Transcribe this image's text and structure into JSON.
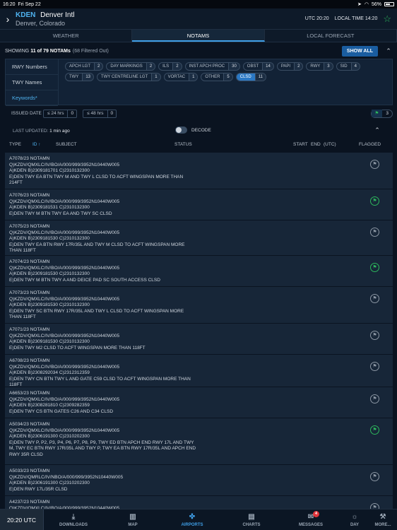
{
  "status_bar": {
    "time": "16:20",
    "date": "Fri Sep 22",
    "battery": "56%"
  },
  "airport": {
    "code": "KDEN",
    "name": "Denver Intl",
    "location": "Denver, Colorado",
    "utc": "UTC 20:20",
    "local": "LOCAL TIME 14:20"
  },
  "tabs": [
    "WEATHER",
    "NOTAMS",
    "LOCAL FORECAST"
  ],
  "summary": {
    "prefix": "SHOWING",
    "count": "11 of 79 NOTAMs",
    "filtered": "(68 Filtered Out)",
    "show_all": "SHOW ALL"
  },
  "filters": {
    "labels": [
      "RWY Numbers",
      "TWY Names",
      "Keywords*"
    ],
    "chips_row1": [
      {
        "label": "APCH LGT",
        "count": "2"
      },
      {
        "label": "DAY MARKINGS",
        "count": "2"
      },
      {
        "label": "ILS",
        "count": "2"
      },
      {
        "label": "INST APCH PROC",
        "count": "30"
      },
      {
        "label": "OBST",
        "count": "14"
      },
      {
        "label": "PAPI",
        "count": "2"
      },
      {
        "label": "RWY",
        "count": "3"
      },
      {
        "label": "SID",
        "count": "4"
      }
    ],
    "chips_row2": [
      {
        "label": "TWY",
        "count": "13"
      },
      {
        "label": "TWY CENTRELINE LGT",
        "count": "1"
      },
      {
        "label": "VORTAC",
        "count": "1"
      },
      {
        "label": "OTHER",
        "count": "5"
      },
      {
        "label": "CLSD",
        "count": "11"
      }
    ],
    "issued_date": {
      "label": "ISSUED DATE",
      "h24": "≤ 24 hrs",
      "h24_count": "0",
      "h48": "≤ 48 hrs",
      "h48_count": "0",
      "flag_count": "3"
    }
  },
  "updated": {
    "label": "LAST UPDATED:",
    "value": "1 min ago",
    "decode": "DECODE"
  },
  "columns": {
    "type": "TYPE",
    "id": "ID ↑",
    "subject": "SUBJECT",
    "status": "STATUS",
    "start": "START",
    "end": "END",
    "utc": "(UTC)",
    "flagged": "FLAGGED"
  },
  "notams": [
    {
      "text": "A7078/23 NOTAMN\nQ)KZDV/QMXLC/IV/BO/A/000/999/3952N10440W005\nA)KDEN B)2309181701 C)2310132300\nE)DEN TWY EA BTN TWY M AND TWY L CLSD TO ACFT WINGSPAN MORE THAN 214FT",
      "flagged": "no"
    },
    {
      "text": "A7076/23 NOTAMN\nQ)KZDV/QMXLC/IV/BO/A/000/999/3952N10440W005\nA)KDEN B)2309181531 C)2310132300\nE)DEN TWY M BTN TWY EA AND TWY SC CLSD",
      "flagged": "yes"
    },
    {
      "text": "A7075/23 NOTAMN\nQ)KZDV/QMXLC/IV/BO/A/000/999/3952N10440W005\nA)KDEN B)2309181530 C)2310132300\nE)DEN TWY EA BTN RWY 17R/35L AND TWY M CLSD TO ACFT WINGSPAN MORE THAN 118FT",
      "flagged": "no"
    },
    {
      "text": "A7074/23 NOTAMN\nQ)KZDV/QMXLC/IV/BO/A/000/999/3952N10440W005\nA)KDEN B)2309181530 C)2310132300\nE)DEN TWY M BTN TWY A AND DEICE PAD SC SOUTH ACCESS CLSD",
      "flagged": "yes"
    },
    {
      "text": "A7073/23 NOTAMN\nQ)KZDV/QMXLC/IV/BO/A/000/999/3952N10440W005\nA)KDEN B)2309181530 C)2310132300\nE)DEN TWY SC BTN RWY 17R/35L AND TWY L CLSD TO ACFT WINGSPAN MORE THAN 118FT",
      "flagged": "no"
    },
    {
      "text": "A7071/23 NOTAMN\nQ)KZDV/QMXLC/IV/BO/A/000/999/3952N10440W005\nA)KDEN B)2309181530 C)2310132300\nE)DEN TWY M2 CLSD TO ACFT WINGSPAN MORE THAN 118FT",
      "flagged": "no"
    },
    {
      "text": "A6708/23 NOTAMN\nQ)KZDV/QMXLC/IV/BO/A/000/999/3952N10440W005\nA)KDEN B)2308292034 C)2312312359\nE)DEN TWY CN BTN TWY L AND GATE C59 CLSD TO ACFT WINGSPAN MORE THAN 118FT",
      "flagged": "no"
    },
    {
      "text": "A6653/23 NOTAMN\nQ)KZDV/QMXLC/IV/BO/A/000/999/3952N10440W005\nA)KDEN B)2308281810 C)2309282359\nE)DEN TWY CS BTN GATES C26 AND C34 CLSD",
      "flagged": "no"
    },
    {
      "text": "A5034/23 NOTAMN\nQ)KZDV/QMXLC/IV/BO/A/000/999/3952N10440W005\nA)KDEN B)2306191300 C)2310202300\nE)DEN TWY P, P2, P3, P4, P6, P7, P8, P9, TWY ED BTN APCH END RWY 17L AND TWY M, TWY EC BTN RWY 17R/35L AND TWY P, TWY EA BTN RWY 17R/35L AND APCH END RWY 35R CLSD",
      "flagged": "yes"
    },
    {
      "text": "A5033/23 NOTAMN\nQ)KZDV/QMRLC/IV/NBO/A/000/999/3952N10440W005\nA)KDEN B)2306191300 C)2310202300\nE)DEN RWY 17L/35R CLSD",
      "flagged": "no"
    },
    {
      "text": "A4237/23 NOTAMN\nQ)KZDV/QMXLC/IV/BO/A/000/999/3952N10440W005",
      "flagged": "no"
    }
  ],
  "tabbar": {
    "clock": "20:20 UTC",
    "items": [
      {
        "label": "DOWNLOADS",
        "icon": "download-icon"
      },
      {
        "label": "MAP",
        "icon": "map-icon"
      },
      {
        "label": "AIRPORTS",
        "icon": "airport-icon"
      },
      {
        "label": "CHARTS",
        "icon": "charts-icon"
      },
      {
        "label": "MESSAGES",
        "icon": "mail-icon",
        "badge": "4"
      },
      {
        "label": "DAY",
        "icon": "sun-icon"
      },
      {
        "label": "MORE...",
        "icon": "wrench-icon"
      }
    ]
  },
  "colors": {
    "accent": "#3f9ee6",
    "flag_on": "#2db65c",
    "badge": "#e0343a",
    "background": "#0a1320"
  }
}
